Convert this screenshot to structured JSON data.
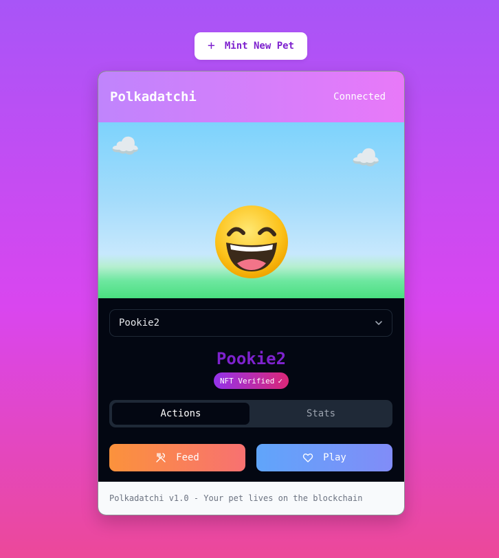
{
  "toolbar": {
    "mint_icon": "plus-icon",
    "mint_label": "Mint New Pet"
  },
  "header": {
    "title": "Polkadatchi",
    "status": "Connected"
  },
  "scene": {
    "cloud_icon": "cloud-icon",
    "pet_icon": "grinning-face-icon"
  },
  "selector": {
    "selected": "Pookie2",
    "icon": "chevron-down-icon"
  },
  "pet": {
    "name": "Pookie2",
    "badge": "NFT Verified",
    "badge_icon": "check-icon"
  },
  "tabs": [
    {
      "label": "Actions",
      "active": true
    },
    {
      "label": "Stats",
      "active": false
    }
  ],
  "actions": {
    "feed_label": "Feed",
    "feed_icon": "utensils-icon",
    "play_label": "Play",
    "play_icon": "heart-icon"
  },
  "footer": {
    "text": "Polkadatchi v1.0 - Your pet lives on the blockchain"
  },
  "colors": {
    "accent": "#7e22ce",
    "feed_start": "#fb923c",
    "feed_end": "#f87171",
    "play_start": "#60a5fa",
    "play_end": "#818cf8",
    "card_body": "#030712"
  }
}
